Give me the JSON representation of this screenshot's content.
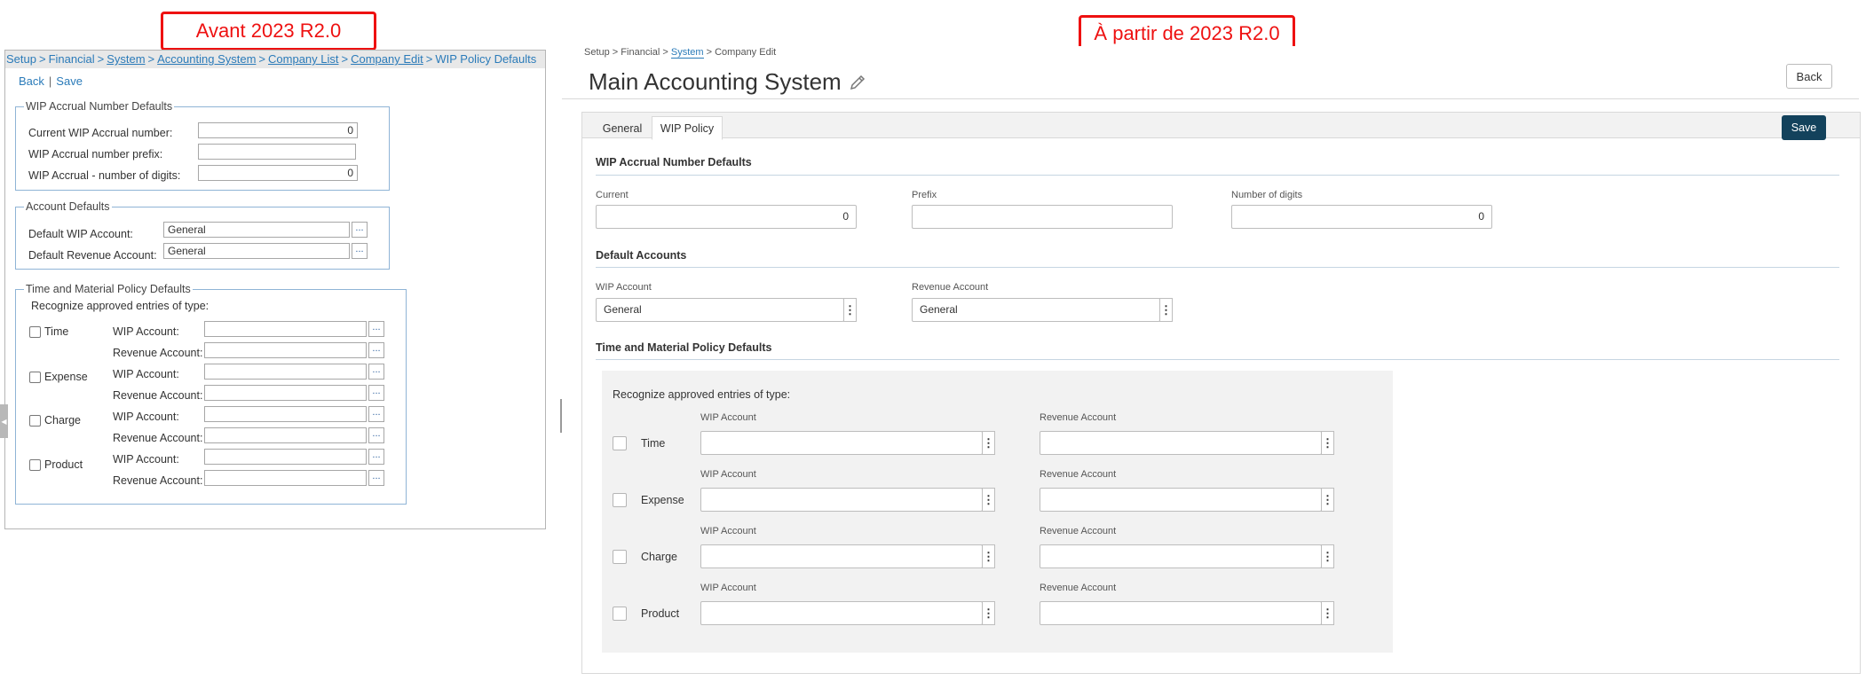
{
  "labels": {
    "before": "Avant 2023 R2.0",
    "after": "À partir de 2023 R2.0"
  },
  "old_ui": {
    "breadcrumb": [
      "Setup",
      "Financial",
      "System",
      "Accounting System",
      "Company List",
      "Company Edit",
      "WIP Policy Defaults"
    ],
    "back": "Back",
    "save": "Save",
    "wip_section": {
      "legend": "WIP Accrual Number Defaults",
      "rows": [
        {
          "label": "Current WIP Accrual number:",
          "value": "0"
        },
        {
          "label": "WIP Accrual number prefix:",
          "value": ""
        },
        {
          "label": "WIP Accrual - number of digits:",
          "value": "0"
        }
      ]
    },
    "account_section": {
      "legend": "Account Defaults",
      "rows": [
        {
          "label": "Default WIP Account:",
          "value": "General"
        },
        {
          "label": "Default Revenue Account:",
          "value": "General"
        }
      ]
    },
    "tm_section": {
      "legend": "Time and Material Policy Defaults",
      "recognize": "Recognize approved entries of type:",
      "wip_label": "WIP Account:",
      "revenue_label": "Revenue Account:",
      "types": [
        "Time",
        "Expense",
        "Charge",
        "Product"
      ]
    },
    "lookup_glyph": "..."
  },
  "new_ui": {
    "breadcrumb": {
      "setup": "Setup",
      "financial": "Financial",
      "system": "System",
      "company_edit": "Company Edit"
    },
    "title": "Main Accounting System",
    "back": "Back",
    "save": "Save",
    "tabs": [
      "General",
      "WIP Policy"
    ],
    "wip_section": {
      "title": "WIP Accrual Number Defaults",
      "current_label": "Current",
      "current_value": "0",
      "prefix_label": "Prefix",
      "prefix_value": "",
      "digits_label": "Number of digits",
      "digits_value": "0"
    },
    "accounts_section": {
      "title": "Default Accounts",
      "wip_label": "WIP Account",
      "wip_value": "General",
      "revenue_label": "Revenue Account",
      "revenue_value": "General"
    },
    "tm_section": {
      "title": "Time and Material Policy Defaults",
      "recognize": "Recognize approved entries of type:",
      "wip_label": "WIP Account",
      "revenue_label": "Revenue Account",
      "types": [
        "Time",
        "Expense",
        "Charge",
        "Product"
      ]
    },
    "more_glyph": "⋮"
  }
}
